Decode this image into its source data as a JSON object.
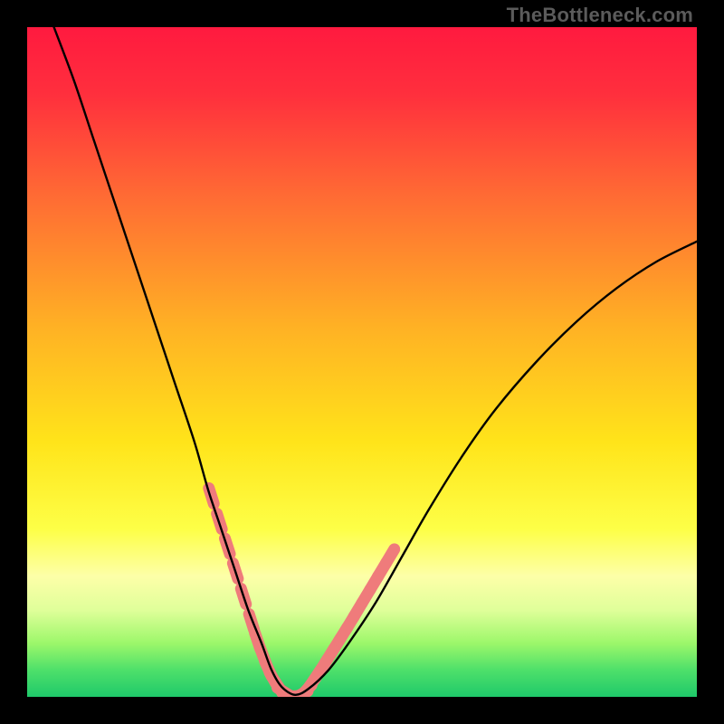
{
  "watermark": {
    "text": "TheBottleneck.com"
  },
  "chart_data": {
    "type": "line",
    "title": "",
    "xlabel": "",
    "ylabel": "",
    "xlim": [
      0,
      100
    ],
    "ylim": [
      0,
      100
    ],
    "grid": false,
    "legend": false,
    "gradient_stops": [
      {
        "offset": 0.0,
        "color": "#ff1a3f"
      },
      {
        "offset": 0.1,
        "color": "#ff2f3d"
      },
      {
        "offset": 0.25,
        "color": "#ff6a34"
      },
      {
        "offset": 0.45,
        "color": "#ffb224"
      },
      {
        "offset": 0.62,
        "color": "#ffe41a"
      },
      {
        "offset": 0.75,
        "color": "#fdff47"
      },
      {
        "offset": 0.82,
        "color": "#fdffa8"
      },
      {
        "offset": 0.87,
        "color": "#e0ff9a"
      },
      {
        "offset": 0.92,
        "color": "#9cf76a"
      },
      {
        "offset": 0.96,
        "color": "#4ee06a"
      },
      {
        "offset": 1.0,
        "color": "#1fc96a"
      }
    ],
    "series": [
      {
        "name": "curve",
        "type": "line",
        "color": "#000000",
        "x": [
          4,
          7,
          10,
          13,
          16,
          19,
          22,
          25,
          27,
          29,
          31,
          33,
          35,
          36.5,
          38,
          40,
          42,
          45,
          48,
          52,
          56,
          60,
          65,
          70,
          76,
          82,
          88,
          94,
          100
        ],
        "y": [
          100,
          92,
          83,
          74,
          65,
          56,
          47,
          38,
          31,
          25,
          19,
          13,
          8,
          4,
          1.5,
          0.3,
          1.2,
          4,
          8,
          14,
          21,
          28,
          36,
          43,
          50,
          56,
          61,
          65,
          68
        ]
      },
      {
        "name": "pink-markers-left",
        "type": "scatter",
        "color": "#ef7b7b",
        "x": [
          27.5,
          28.7,
          29.9,
          31.1,
          32.3,
          33.5,
          34.4,
          35.2,
          36.0,
          36.8,
          37.6
        ],
        "y": [
          30.0,
          26.2,
          22.5,
          18.8,
          15.0,
          11.2,
          8.4,
          6.2,
          4.2,
          2.6,
          1.4
        ]
      },
      {
        "name": "pink-markers-bottom",
        "type": "scatter",
        "color": "#ef7b7b",
        "x": [
          38.4,
          39.2,
          40.0,
          40.8,
          41.6,
          42.4,
          43.2
        ],
        "y": [
          0.7,
          0.2,
          0.1,
          0.3,
          0.9,
          1.9,
          3.1
        ]
      },
      {
        "name": "pink-markers-right",
        "type": "scatter",
        "color": "#ef7b7b",
        "x": [
          44.2,
          45.2,
          46.2,
          47.2,
          48.2,
          49.4,
          50.6,
          51.8,
          53.0,
          54.2
        ],
        "y": [
          4.6,
          6.2,
          7.8,
          9.4,
          11.0,
          13.0,
          15.0,
          17.0,
          19.0,
          21.0
        ]
      }
    ]
  }
}
